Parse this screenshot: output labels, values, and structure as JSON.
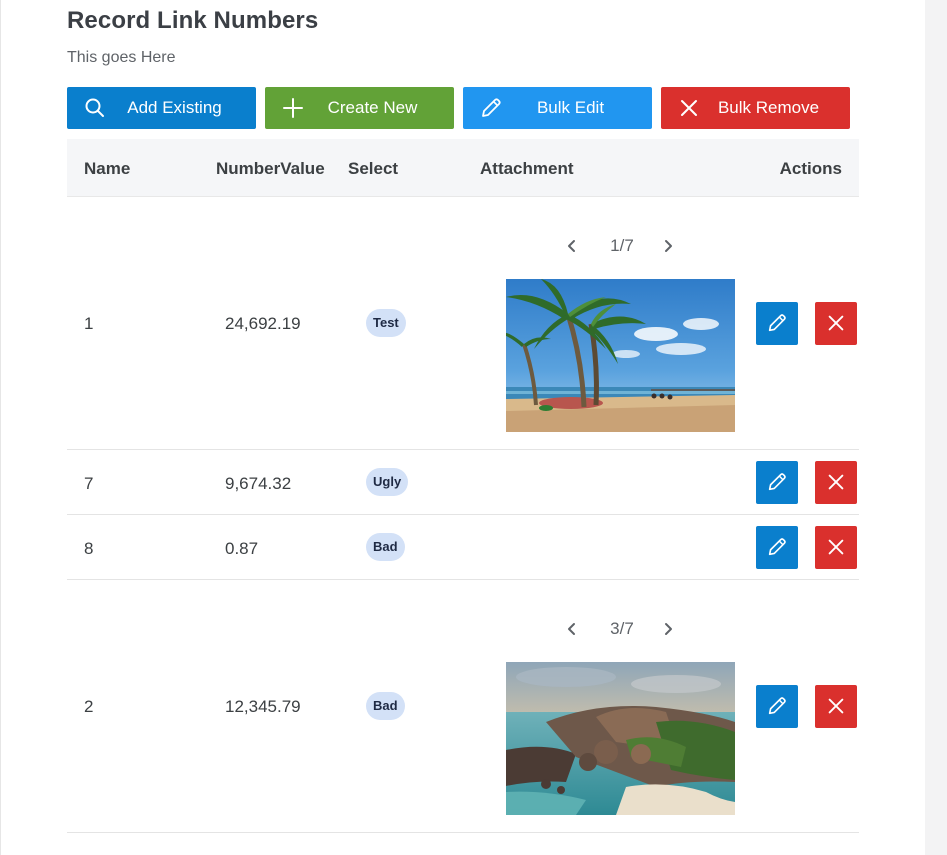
{
  "header": {
    "title": "Record Link Numbers",
    "subtitle": "This goes Here"
  },
  "toolbar": {
    "add_existing_label": "Add Existing",
    "create_new_label": "Create New",
    "bulk_edit_label": "Bulk Edit",
    "bulk_remove_label": "Bulk Remove",
    "colors": {
      "add_existing": "#0a7fcd",
      "create_new": "#62a237",
      "bulk_edit": "#2196f0",
      "bulk_remove": "#da302d"
    },
    "icons": [
      "search-icon",
      "plus-icon",
      "pencil-icon",
      "close-icon"
    ]
  },
  "table": {
    "columns": [
      "Name",
      "NumberValue",
      "Select",
      "Attachment",
      "Actions"
    ],
    "rows": [
      {
        "name": "1",
        "number": "24,692.19",
        "select": "Test",
        "attachment": {
          "pager": "1/7",
          "image": "tropical-beach-palm-trees-photo"
        }
      },
      {
        "name": "7",
        "number": "9,674.32",
        "select": "Ugly"
      },
      {
        "name": "8",
        "number": "0.87",
        "select": "Bad"
      },
      {
        "name": "2",
        "number": "12,345.79",
        "select": "Bad",
        "attachment": {
          "pager": "3/7",
          "image": "rocky-coastline-island-photo"
        }
      }
    ],
    "row_action_icons": [
      "pencil-icon",
      "close-icon"
    ]
  }
}
